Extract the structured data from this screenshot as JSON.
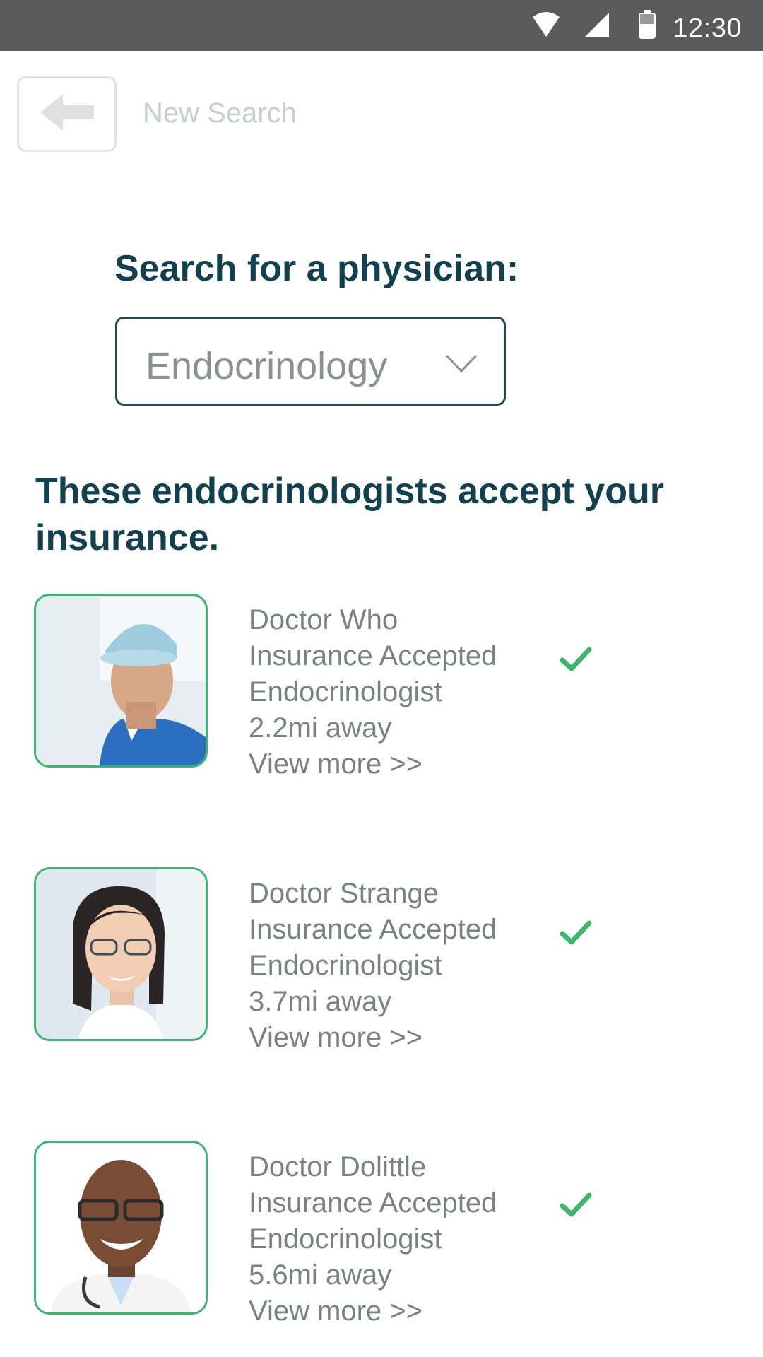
{
  "status_bar": {
    "time": "12:30",
    "icons": [
      "wifi-icon",
      "cell-signal-icon",
      "battery-icon"
    ]
  },
  "nav": {
    "back_icon": "arrow-left-icon",
    "new_search_label": "New Search"
  },
  "search": {
    "heading": "Search for a physician:",
    "specialty_selected": "Endocrinology",
    "dropdown_icon": "chevron-down-icon"
  },
  "results": {
    "heading": "These endocrinologists accept your insurance.",
    "doctors": [
      {
        "name": "Doctor Who",
        "insurance": "Insurance Accepted",
        "specialty": "Endocrinologist",
        "distance": "2.2mi away",
        "view_more": "View more >>"
      },
      {
        "name": "Doctor Strange",
        "insurance": "Insurance Accepted",
        "specialty": "Endocrinologist",
        "distance": "3.7mi away",
        "view_more": "View more >>"
      },
      {
        "name": "Doctor Dolittle",
        "insurance": "Insurance Accepted",
        "specialty": "Endocrinologist",
        "distance": "5.6mi away",
        "view_more": "View more >>"
      }
    ]
  },
  "colors": {
    "status_bar_bg": "#5a5a5a",
    "heading": "#12404f",
    "accent_green": "#3db56e",
    "body_text": "#7c7f83",
    "muted_text": "#c9cdd0"
  }
}
